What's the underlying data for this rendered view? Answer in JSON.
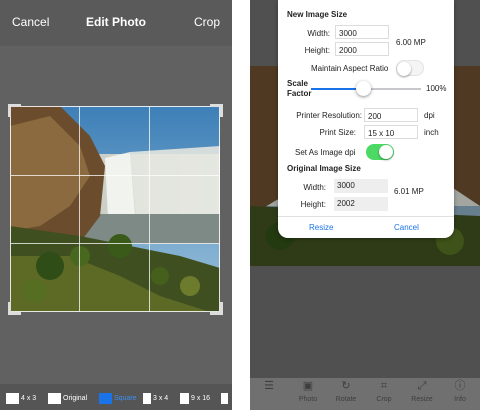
{
  "colors": {
    "accent": "#1a73e8",
    "toggle_on": "#4cd964"
  },
  "left_screen": {
    "header": {
      "cancel_label": "Cancel",
      "title": "Edit Photo",
      "crop_label": "Crop"
    },
    "aspect_ratios": [
      {
        "label": "4 x 3",
        "selected": false
      },
      {
        "label": "Original",
        "selected": false
      },
      {
        "label": "Square",
        "selected": true
      },
      {
        "label": "3 x 4",
        "selected": false
      },
      {
        "label": "9 x 16",
        "selected": false
      },
      {
        "label": "",
        "selected": false
      }
    ]
  },
  "right_screen": {
    "dialog": {
      "new_size": {
        "heading": "New Image Size",
        "width_label": "Width:",
        "width_value": "3000",
        "height_label": "Height:",
        "height_value": "2000",
        "megapixels": "6.00 MP",
        "aspect_label": "Maintain Aspect Ratio",
        "aspect_on": false,
        "scale_label_1": "Scale",
        "scale_label_2": "Factor",
        "scale_percent": 100,
        "scale_value": "100%"
      },
      "printer": {
        "resolution_label": "Printer Resolution:",
        "resolution_value": "200",
        "resolution_unit": "dpi",
        "print_size_label": "Print Size:",
        "print_size_value": "15 x 10",
        "print_size_unit": "inch",
        "set_dpi_label": "Set As Image dpi",
        "set_dpi_on": true
      },
      "original_size": {
        "heading": "Original Image Size",
        "width_label": "Width:",
        "width_value": "3000",
        "height_label": "Height:",
        "height_value": "2002",
        "megapixels": "6.01 MP"
      },
      "resize_label": "Resize",
      "cancel_label": "Cancel"
    },
    "tabs": [
      {
        "icon": "menu-icon",
        "glyph": "☰",
        "label": ""
      },
      {
        "icon": "photo-icon",
        "glyph": "▣",
        "label": "Photo"
      },
      {
        "icon": "rotate-icon",
        "glyph": "↻",
        "label": "Rotate"
      },
      {
        "icon": "crop-icon",
        "glyph": "⌗",
        "label": "Crop"
      },
      {
        "icon": "resize-icon",
        "glyph": "⤢",
        "label": "Resize"
      },
      {
        "icon": "info-icon",
        "glyph": "ⓘ",
        "label": "Info"
      }
    ]
  }
}
